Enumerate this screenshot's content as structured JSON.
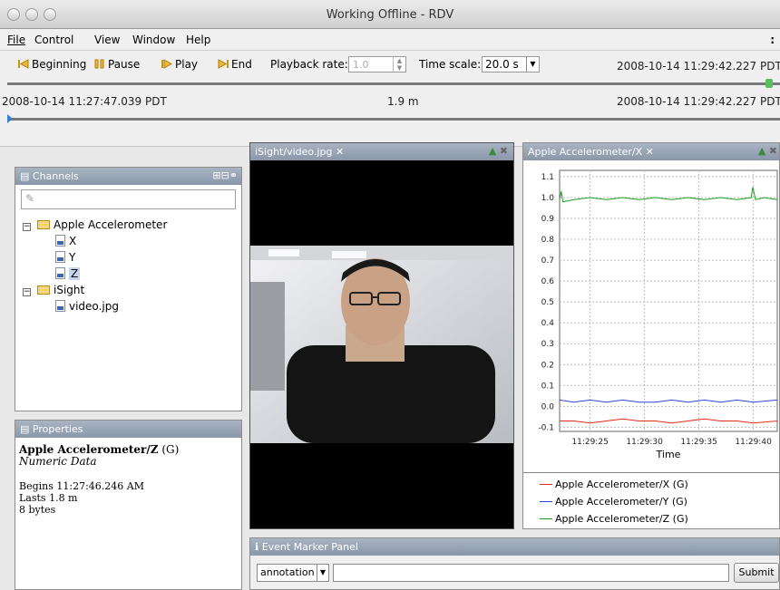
{
  "window": {
    "title": "Working Offline - RDV"
  },
  "menu": [
    "File",
    "Control",
    "View",
    "Window",
    "Help"
  ],
  "toolbar": {
    "beginning": "Beginning",
    "pause": "Pause",
    "play": "Play",
    "end": "End",
    "playback_rate_label": "Playback rate:",
    "playback_rate_value": "1.0",
    "time_scale_label": "Time scale:",
    "time_scale_value": "20.0 s",
    "time_top_right": "2008-10-14 11:29:42.227 PDT",
    "time_start": "2008-10-14 11:27:47.039 PDT",
    "duration": "1.9 m",
    "time_end": "2008-10-14 11:29:42.227 PDT",
    "top_slider_position": 1.0,
    "bottom_slider_position": 0.0
  },
  "channels": {
    "title": "Channels",
    "tree": [
      {
        "label": "Apple Accelerometer",
        "children": [
          "X",
          "Y",
          "Z"
        ]
      },
      {
        "label": "iSight",
        "children": [
          "video.jpg"
        ]
      }
    ],
    "selected": "Z"
  },
  "properties": {
    "title": "Properties",
    "name": "Apple Accelerometer/Z",
    "suffix": "(G)",
    "type": "Numeric Data",
    "begins": "Begins 11:27:46.246 AM",
    "lasts": "Lasts 1.8 m",
    "size": "8 bytes"
  },
  "video_panel": {
    "title": "iSight/video.jpg"
  },
  "chart_panel": {
    "title": "Apple Accelerometer/X"
  },
  "event_panel": {
    "title": "Event Marker Panel",
    "type_value": "annotation",
    "input_value": "",
    "submit": "Submit"
  },
  "colors": {
    "x": "#e02a1a",
    "y": "#2b45d8",
    "z": "#1a9e1a",
    "header": "#8997a9"
  },
  "chart_data": {
    "type": "line",
    "xlabel": "Time",
    "ylabel": "",
    "x_ticks": [
      "11:29:25",
      "11:29:30",
      "11:29:35",
      "11:29:40"
    ],
    "x_tick_seconds": [
      25,
      30,
      35,
      40
    ],
    "xlim": [
      22.2,
      42.2
    ],
    "y_ticks": [
      "1.1",
      "1.0",
      "0.9",
      "0.8",
      "0.7",
      "0.6",
      "0.5",
      "0.4",
      "0.3",
      "0.2",
      "0.1",
      "0.0",
      "-0.1"
    ],
    "ylim": [
      -0.12,
      1.13
    ],
    "grid": true,
    "legend_position": "bottom",
    "series": [
      {
        "name": "Apple Accelerometer/X (G)",
        "color": "#e02a1a",
        "x": [
          22.2,
          23.5,
          25,
          26.5,
          28,
          29.5,
          31,
          32.5,
          34,
          35.5,
          37,
          38.5,
          40,
          42.2
        ],
        "y": [
          -0.07,
          -0.07,
          -0.08,
          -0.07,
          -0.06,
          -0.07,
          -0.07,
          -0.08,
          -0.07,
          -0.06,
          -0.07,
          -0.07,
          -0.08,
          -0.07
        ]
      },
      {
        "name": "Apple Accelerometer/Y (G)",
        "color": "#2b45d8",
        "x": [
          22.2,
          23.5,
          25,
          26.5,
          28,
          29.5,
          31,
          32.5,
          34,
          35.5,
          37,
          38.5,
          40,
          42.2
        ],
        "y": [
          0.03,
          0.02,
          0.03,
          0.02,
          0.03,
          0.02,
          0.02,
          0.03,
          0.02,
          0.03,
          0.02,
          0.03,
          0.02,
          0.03
        ]
      },
      {
        "name": "Apple Accelerometer/Z (G)",
        "color": "#1a9e1a",
        "x": [
          22.2,
          22.35,
          22.5,
          23.5,
          25,
          26.5,
          28,
          29.5,
          31,
          32.5,
          34,
          35.5,
          37,
          38.5,
          39.8,
          39.95,
          40.2,
          41,
          42.2
        ],
        "y": [
          0.99,
          1.03,
          0.98,
          0.99,
          1.0,
          0.99,
          1.0,
          0.99,
          1.0,
          0.99,
          1.0,
          0.99,
          1.0,
          0.99,
          1.0,
          1.05,
          0.99,
          1.0,
          0.99
        ]
      }
    ]
  }
}
